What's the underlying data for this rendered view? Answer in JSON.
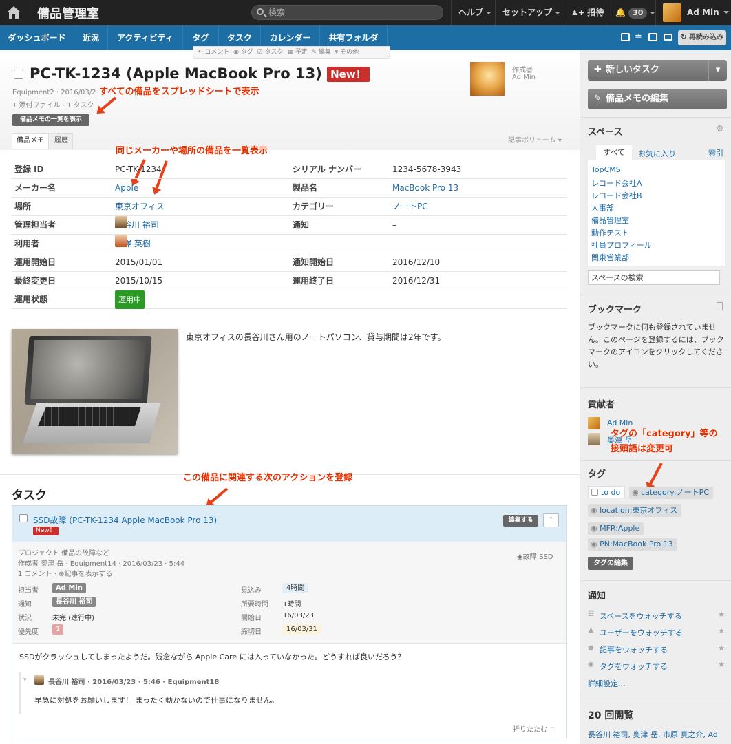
{
  "topbar": {
    "app_title": "備品管理室",
    "search_placeholder": "検索",
    "help": "ヘルプ",
    "setup": "セットアップ",
    "invite": "招待",
    "notif_count": "30",
    "user": "Ad Min"
  },
  "nav": {
    "items": [
      "ダッシュボード",
      "近況",
      "アクティビティ",
      "タグ",
      "タスク",
      "カレンダー",
      "共有フォルダ"
    ],
    "reload": "再読み込み"
  },
  "toolstrip": [
    "コメント",
    "タグ",
    "タスク",
    "予定",
    "編集",
    "その他"
  ],
  "article": {
    "title": "PC-TK-1234 (Apple MacBook Pro 13)",
    "new_badge": "New！",
    "meta1": "Equipment2 · 2016/03/2",
    "meta2": "1 添付ファイル · 1 タスク",
    "list_button": "備品メモの一覧を表示",
    "author_label": "作成者",
    "author_name": "Ad Min",
    "tabs": [
      "備品メモ",
      "履歴"
    ],
    "volume": "記事ボリューム",
    "description": "東京オフィスの長谷川さん用のノートパソコン、貸与期間は2年です。"
  },
  "annotations": {
    "a1": "すべての備品をスプレッドシートで表示",
    "a2": "同じメーカーや場所の備品を一覧表示",
    "a3": "この備品に関連する次のアクションを登録",
    "a4_line1": "タグの「category」等の",
    "a4_line2": "接頭語は変更可"
  },
  "fields": {
    "reg_id_label": "登録 ID",
    "reg_id": "PC-TK-1234",
    "serial_label": "シリアル ナンバー",
    "serial": "1234-5678-3943",
    "maker_label": "メーカー名",
    "maker": "Apple",
    "product_label": "製品名",
    "product": "MacBook Pro 13",
    "place_label": "場所",
    "place": "東京オフィス",
    "category_label": "カテゴリー",
    "category": "ノートPC",
    "manager_label": "管理担当者",
    "manager": "長谷川 裕司",
    "notify_label": "通知",
    "notify": "–",
    "user_label": "利用者",
    "user": "相澤 英樹",
    "start_label": "運用開始日",
    "start": "2015/01/01",
    "notify_start_label": "通知開始日",
    "notify_start": "2016/12/10",
    "changed_label": "最終変更日",
    "changed": "2015/10/15",
    "end_label": "運用終了日",
    "end": "2016/12/31",
    "status_label": "運用状態",
    "status": "運用中"
  },
  "tasks": {
    "heading": "タスク",
    "title": "SSD故障 (PC-TK-1234 Apple MacBook Pro 13)",
    "new_badge": "New！",
    "edit_button": "編集する",
    "project": "プロジェクト 備品の故障など",
    "creator": "作成者 奥津 岳 · Equipment14 · 2016/03/23 · 5:44",
    "comments": "1 コメント · ",
    "show_article": "記事を表示する",
    "tag": "故障:SSD",
    "assignee_label": "担当者",
    "assignee": "Ad Min",
    "notify_label": "通知",
    "notify": "長谷川 裕司",
    "state_label": "状況",
    "state": "未完 (進行中)",
    "priority_label": "優先度",
    "priority": "1",
    "estimate_label": "見込み",
    "estimate": "4時間",
    "spent_label": "所要時間",
    "spent": "1時間",
    "start_label": "開始日",
    "start": "16/03/23",
    "due_label": "締切日",
    "due": "16/03/31",
    "body": "SSDがクラッシュしてしまったようだ。残念ながら Apple Care には入っていなかった。どうすれば良いだろう？",
    "reply_meta": "長谷川 裕司 · 2016/03/23 · 5:46 · Equipment18",
    "reply_body": "早急に対処をお願いします！ まったく動かないので仕事になりません。",
    "collapse": "折りたたむ"
  },
  "sidebar": {
    "new_task": "新しいタスク",
    "edit_memo": "備品メモの編集",
    "spaces_title": "スペース",
    "spaces_tabs": [
      "すべて",
      "お気に入り",
      "索引"
    ],
    "spaces": [
      "TopCMS",
      "レコード会社A",
      "レコード会社B",
      "人事部",
      "備品管理室",
      "動作テスト",
      "社員プロフィール",
      "関東営業部"
    ],
    "space_search_placeholder": "スペースの検索",
    "bookmark_title": "ブックマーク",
    "bookmark_text": "ブックマークに何も登録されていません。このページを登録するには、ブックマークのアイコンをクリックしてください。",
    "contrib_title": "貢献者",
    "contributors": [
      "Ad Min",
      "奥津 岳"
    ],
    "tags_title": "タグ",
    "tags": [
      "to do",
      "category:ノートPC",
      "location:東京オフィス",
      "MFR:Apple",
      "PN:MacBook Pro 13"
    ],
    "tag_edit": "タグの編集",
    "notify_title": "通知",
    "notify_links": [
      "スペースをウォッチする",
      "ユーザーをウォッチする",
      "記事をウォッチする",
      "タグをウォッチする"
    ],
    "notify_detail": "詳細設定...",
    "views_title": "20 回閲覧",
    "viewers": "長谷川 裕司, 奥津 岳, 市原 真之介, Ad"
  }
}
